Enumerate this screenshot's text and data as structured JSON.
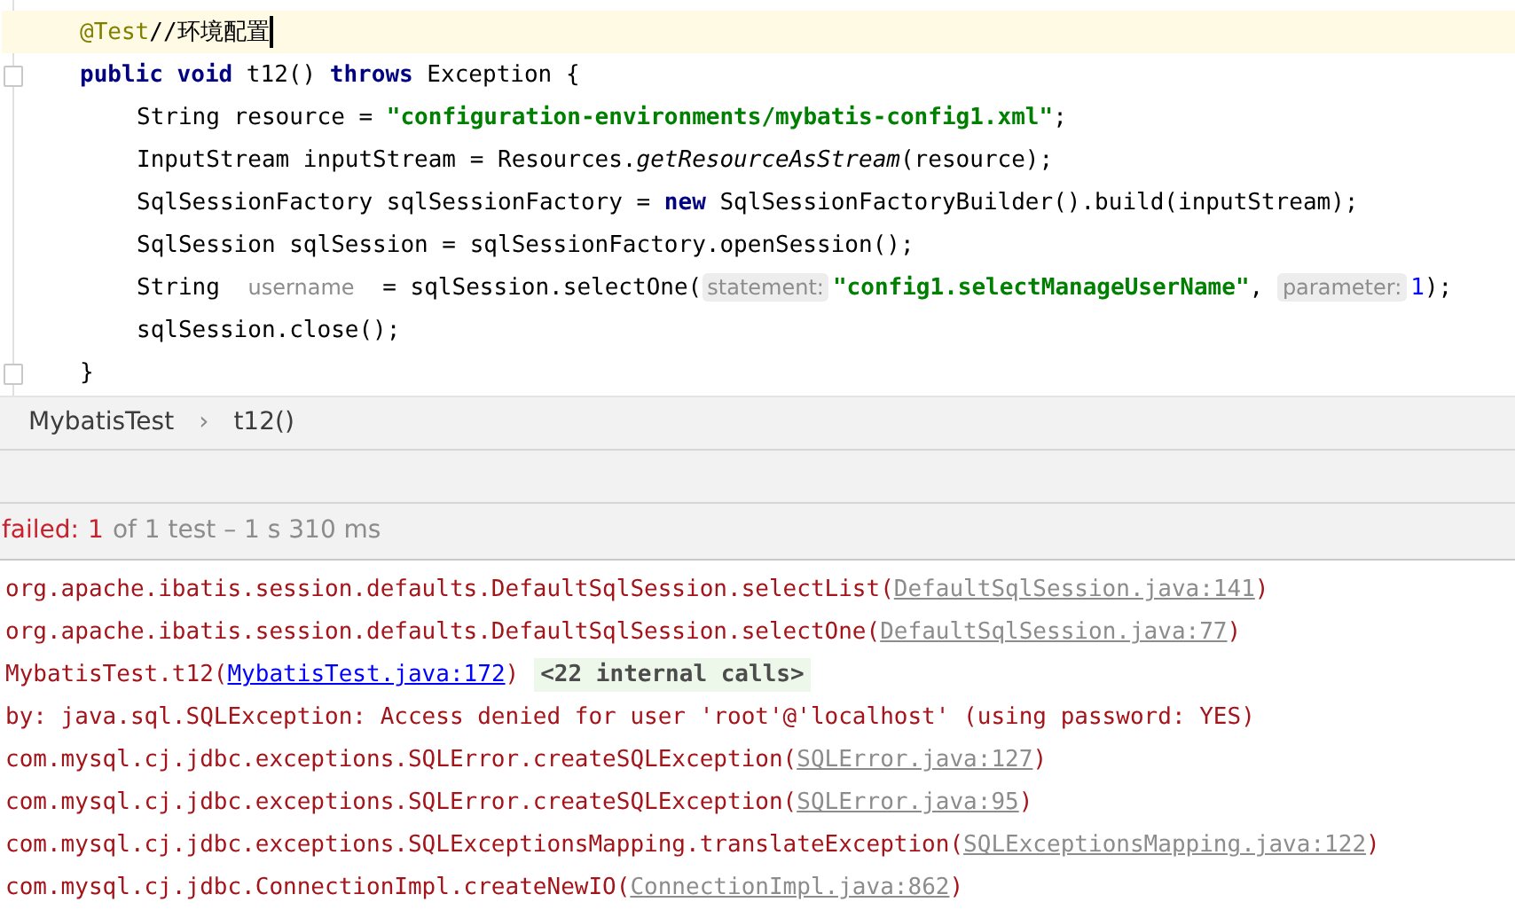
{
  "editor": {
    "lines": [
      {
        "highlighted": true,
        "cursor": true,
        "tokens": [
          {
            "kind": "annotation",
            "text": "@Test"
          },
          {
            "kind": "plain",
            "text": "//环境配置"
          }
        ]
      },
      {
        "highlighted": false,
        "fold": true,
        "tokens": [
          {
            "kind": "keyword",
            "text": "public void"
          },
          {
            "kind": "plain",
            "text": " t12() "
          },
          {
            "kind": "keyword",
            "text": "throws"
          },
          {
            "kind": "plain",
            "text": " Exception {"
          }
        ],
        "children": [
          {
            "highlighted": false,
            "tokens": [
              {
                "kind": "plain",
                "text": "String resource = "
              },
              {
                "kind": "string",
                "text": "\"configuration-environments/mybatis-config1.xml\""
              },
              {
                "kind": "plain",
                "text": ";"
              }
            ]
          },
          {
            "highlighted": false,
            "tokens": [
              {
                "kind": "plain",
                "text": "InputStream inputStream = Resources."
              },
              {
                "kind": "static",
                "text": "getResourceAsStream"
              },
              {
                "kind": "plain",
                "text": "(resource);"
              }
            ]
          },
          {
            "highlighted": false,
            "tokens": [
              {
                "kind": "plain",
                "text": "SqlSessionFactory sqlSessionFactory = "
              },
              {
                "kind": "keyword",
                "text": "new"
              },
              {
                "kind": "plain",
                "text": " SqlSessionFactoryBuilder().build(inputStream);"
              }
            ]
          },
          {
            "highlighted": false,
            "tokens": [
              {
                "kind": "plain",
                "text": "SqlSession sqlSession = sqlSessionFactory.openSession();"
              }
            ]
          },
          {
            "highlighted": false,
            "tokens": [
              {
                "kind": "plain",
                "text": "String "
              },
              {
                "kind": "hint",
                "text": "username"
              },
              {
                "kind": "plain",
                "text": " = sqlSession.selectOne("
              },
              {
                "kind": "hint-box",
                "text": "statement:"
              },
              {
                "kind": "string",
                "text": "\"config1.selectManageUserName\""
              },
              {
                "kind": "plain",
                "text": ", "
              },
              {
                "kind": "hint-box",
                "text": "parameter:"
              },
              {
                "kind": "number",
                "text": "1"
              },
              {
                "kind": "plain",
                "text": ");"
              }
            ]
          },
          {
            "highlighted": false,
            "tokens": [
              {
                "kind": "plain",
                "text": "sqlSession.close();"
              }
            ]
          }
        ]
      },
      {
        "highlighted": false,
        "fold": true,
        "tokens": [
          {
            "kind": "plain",
            "text": "}"
          }
        ]
      }
    ]
  },
  "breadcrumb": [
    "MybatisTest",
    "›",
    "t12()"
  ],
  "status": [
    {
      "kind": "failed",
      "text": "failed:"
    },
    {
      "kind": "failed",
      "text": "1"
    },
    {
      "kind": "info",
      "text": "of 1 test – 1 s 310 ms"
    }
  ],
  "console": [
    [
      {
        "kind": "text",
        "text": "org.apache.ibatis.session.defaults.DefaultSqlSession.selectList("
      },
      {
        "kind": "file-link",
        "text": "DefaultSqlSession.java:141"
      },
      {
        "kind": "text",
        "text": ")"
      }
    ],
    [
      {
        "kind": "text",
        "text": "org.apache.ibatis.session.defaults.DefaultSqlSession.selectOne("
      },
      {
        "kind": "file-link",
        "text": "DefaultSqlSession.java:77"
      },
      {
        "kind": "text",
        "text": ")"
      }
    ],
    [
      {
        "kind": "text",
        "text": "MybatisTest.t12("
      },
      {
        "kind": "own-link",
        "text": "MybatisTest.java:172"
      },
      {
        "kind": "text",
        "text": ")"
      },
      {
        "kind": "internal",
        "text": "<22 internal calls>"
      }
    ],
    [
      {
        "kind": "text",
        "text": "by: java.sql.SQLException: Access denied for user 'root'@'localhost' (using password: YES)"
      }
    ],
    [
      {
        "kind": "text",
        "text": "com.mysql.cj.jdbc.exceptions.SQLError.createSQLException("
      },
      {
        "kind": "file-link",
        "text": "SQLError.java:127"
      },
      {
        "kind": "text",
        "text": ")"
      }
    ],
    [
      {
        "kind": "text",
        "text": "com.mysql.cj.jdbc.exceptions.SQLError.createSQLException("
      },
      {
        "kind": "file-link",
        "text": "SQLError.java:95"
      },
      {
        "kind": "text",
        "text": ")"
      }
    ],
    [
      {
        "kind": "text",
        "text": "com.mysql.cj.jdbc.exceptions.SQLExceptionsMapping.translateException("
      },
      {
        "kind": "file-link",
        "text": "SQLExceptionsMapping.java:122"
      },
      {
        "kind": "text",
        "text": ")"
      }
    ],
    [
      {
        "kind": "text",
        "text": "com.mysql.cj.jdbc.ConnectionImpl.createNewIO("
      },
      {
        "kind": "file-link",
        "text": "ConnectionImpl.java:862"
      },
      {
        "kind": "text",
        "text": ")"
      }
    ]
  ]
}
